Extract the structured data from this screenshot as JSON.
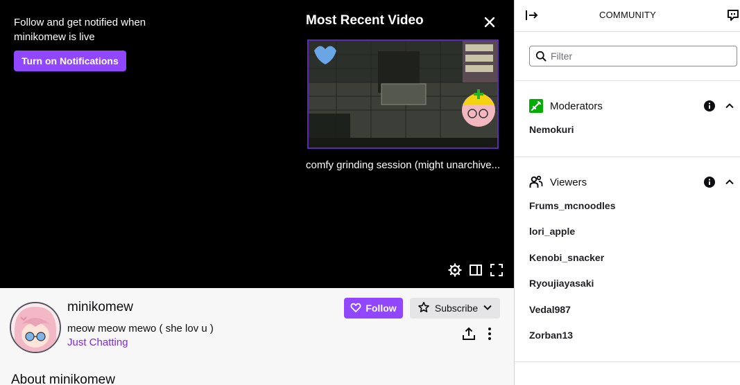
{
  "player": {
    "follow_prompt": "Follow and get notified when minikomew is live",
    "notify_button": "Turn on Notifications",
    "recent_heading": "Most Recent Video",
    "recent_video_title": "comfy grinding session (might unarchive...",
    "icons": [
      "close-icon",
      "settings-icon",
      "theatre-mode-icon",
      "fullscreen-icon"
    ]
  },
  "channel": {
    "name": "minikomew",
    "stream_title": "meow meow mewo ( she lov u )",
    "category": "Just Chatting",
    "follow_label": "Follow",
    "subscribe_label": "Subscribe",
    "about_heading": "About minikomew",
    "icons": [
      "heart-icon",
      "star-icon",
      "chevron-down-icon",
      "share-icon",
      "more-icon"
    ]
  },
  "community": {
    "title": "COMMUNITY",
    "filter_placeholder": "Filter",
    "moderators": {
      "title": "Moderators",
      "users": [
        "Nemokuri"
      ]
    },
    "viewers": {
      "title": "Viewers",
      "users": [
        "Frums_mcnoodles",
        "lori_apple",
        "Kenobi_snacker",
        "Ryoujiayasaki",
        "Vedal987",
        "Zorban13"
      ]
    }
  },
  "colors": {
    "brand": "#9147ff",
    "link": "#772ce8",
    "moderator_badge": "#00ad03",
    "player_bg": "#000000"
  }
}
